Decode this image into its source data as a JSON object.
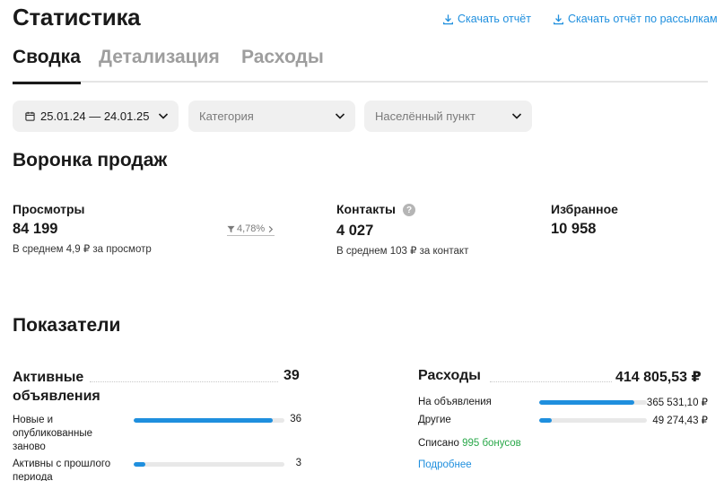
{
  "header": {
    "title": "Статистика",
    "download_report": "Скачать отчёт",
    "download_mailing_report": "Скачать отчёт по рассылкам"
  },
  "tabs": [
    {
      "label": "Сводка",
      "active": true
    },
    {
      "label": "Детализация",
      "active": false
    },
    {
      "label": "Расходы",
      "active": false
    }
  ],
  "filters": {
    "date_range": "25.01.24 — 24.01.25",
    "category_placeholder": "Категория",
    "city_placeholder": "Населённый пункт"
  },
  "funnel": {
    "title": "Воронка продаж",
    "views": {
      "label": "Просмотры",
      "value": "84 199",
      "sub": "В среднем 4,9 ₽ за просмотр",
      "trend": "4,78%"
    },
    "contacts": {
      "label": "Контакты",
      "value": "4 027",
      "sub": "В среднем 103 ₽ за контакт"
    },
    "favorites": {
      "label": "Избранное",
      "value": "10 958"
    }
  },
  "indicators": {
    "title": "Показатели",
    "active_ads": {
      "label": "Активные объявления",
      "value": "39",
      "rows": [
        {
          "label": "Новые и опубликованные заново",
          "value": "36",
          "fraction": 0.923
        },
        {
          "label": "Активны с прошлого периода",
          "value": "3",
          "fraction": 0.077
        }
      ]
    },
    "expenses": {
      "label": "Расходы",
      "value": "414 805,53 ₽",
      "rows": [
        {
          "label": "На объявления",
          "value": "365 531,10 ₽",
          "fraction": 0.881
        },
        {
          "label": "Другие",
          "value": "49 274,43 ₽",
          "fraction": 0.119
        }
      ],
      "written_off_prefix": "Списано",
      "written_off_bonus": "995 бонусов",
      "more_link": "Подробнее"
    }
  },
  "colors": {
    "accent": "#1f8fde",
    "bonus_green": "#2aa84a",
    "filter_bg": "#f0f0f0"
  }
}
